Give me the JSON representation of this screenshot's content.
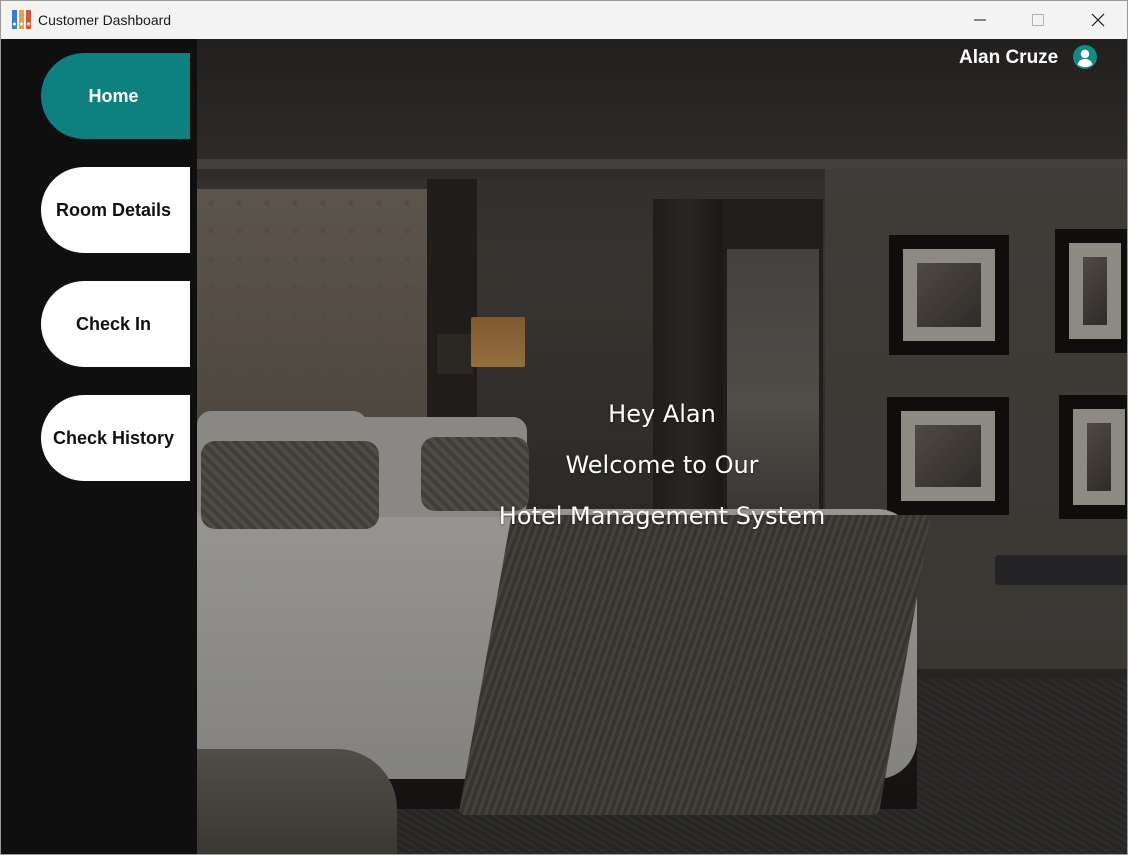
{
  "window": {
    "title": "Customer Dashboard",
    "controls": [
      "minimize",
      "maximize",
      "close"
    ]
  },
  "sidebar": {
    "items": [
      {
        "label": "Home",
        "active": true
      },
      {
        "label": "Room Details",
        "active": false
      },
      {
        "label": "Check In",
        "active": false
      },
      {
        "label": "Check History",
        "active": false
      }
    ]
  },
  "header": {
    "user_name": "Alan Cruze",
    "user_icon": "user-avatar-icon"
  },
  "hero": {
    "greeting": "Hey Alan",
    "line2": "Welcome to Our",
    "line3": "Hotel Management System"
  },
  "colors": {
    "accent": "#0e8080",
    "sidebar_bg": "#0f0f0f",
    "nav_bg": "#ffffff"
  }
}
